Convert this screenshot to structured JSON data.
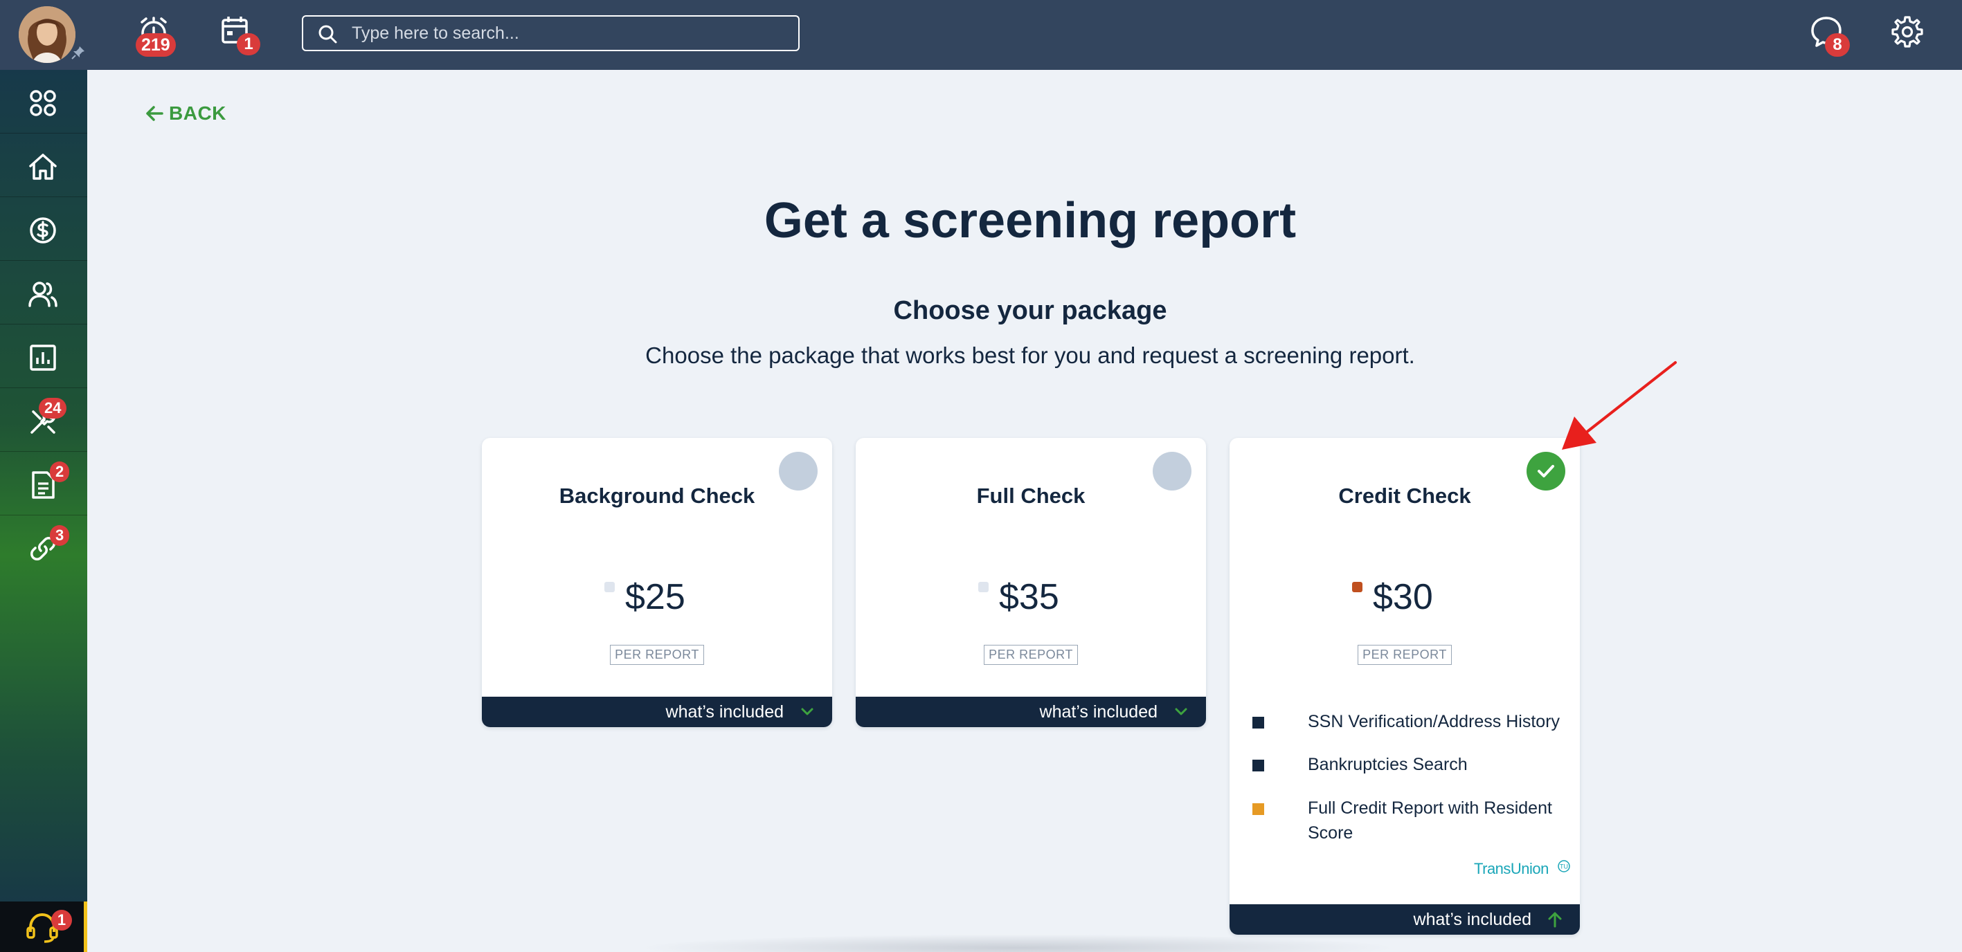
{
  "topbar": {
    "alarm_badge": "219",
    "calendar_badge": "1",
    "search_placeholder": "Type here to search...",
    "messages_badge": "8",
    "icons": [
      "avatar",
      "pin-icon",
      "alarm-icon",
      "calendar-icon",
      "search-icon",
      "chat-icon",
      "gear-icon"
    ]
  },
  "sidebar": {
    "items": [
      {
        "icon": "apps-grid-icon",
        "badge": ""
      },
      {
        "icon": "home-icon",
        "badge": ""
      },
      {
        "icon": "dollar-icon",
        "badge": ""
      },
      {
        "icon": "people-icon",
        "badge": ""
      },
      {
        "icon": "bar-chart-icon",
        "badge": ""
      },
      {
        "icon": "tools-icon",
        "badge": "24"
      },
      {
        "icon": "document-icon",
        "badge": "2"
      },
      {
        "icon": "link-icon",
        "badge": "3"
      }
    ],
    "support_badge": "1"
  },
  "main": {
    "back_label": "BACK",
    "title": "Get a screening report",
    "subtitle": "Choose your package",
    "description": "Choose the package that works best for you and request a screening report."
  },
  "packages": [
    {
      "name": "Background Check",
      "price": "$25",
      "per": "PER REPORT",
      "selected": false,
      "dot_color": "#dfe5ee",
      "footer": "what’s included",
      "expanded": false
    },
    {
      "name": "Full Check",
      "price": "$35",
      "per": "PER REPORT",
      "selected": false,
      "dot_color": "#dfe5ee",
      "footer": "what’s included",
      "expanded": false
    },
    {
      "name": "Credit Check",
      "price": "$30",
      "per": "PER REPORT",
      "selected": true,
      "dot_color": "#c0501f",
      "footer": "what’s included",
      "expanded": true,
      "features": [
        {
          "text": "SSN Verification/Address History",
          "color": "#14273f"
        },
        {
          "text": "Bankruptcies Search",
          "color": "#14273f"
        },
        {
          "text": "Full Credit Report with Resident Score",
          "color": "#e69a24"
        }
      ],
      "provider": "TransUnion",
      "provider_mark": "TU"
    }
  ],
  "colors": {
    "topbar": "#33455e",
    "accent_green": "#3ea33f",
    "navy": "#14273f",
    "badge_red": "#d93b3b",
    "annotation_arrow": "#e8201d"
  }
}
